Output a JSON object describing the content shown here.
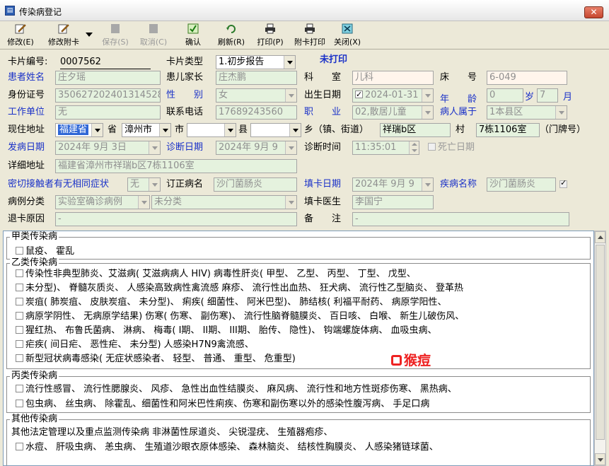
{
  "window": {
    "title": "传染病登记",
    "close_label": "✕"
  },
  "toolbar": {
    "buttons": [
      {
        "label": "修改(E)",
        "icon": "edit-icon",
        "enabled": true
      },
      {
        "label": "修改附卡",
        "icon": "edit-attachment-icon",
        "enabled": true
      },
      {
        "label": "保存(S)",
        "icon": "save-icon",
        "enabled": false
      },
      {
        "label": "取消(C)",
        "icon": "cancel-icon",
        "enabled": false
      },
      {
        "label": "确认",
        "icon": "confirm-icon",
        "enabled": true
      },
      {
        "label": "刷新(R)",
        "icon": "refresh-icon",
        "enabled": true
      },
      {
        "label": "打印(P)",
        "icon": "printer-icon",
        "enabled": true
      },
      {
        "label": "附卡打印",
        "icon": "attachment-printer-icon",
        "enabled": true
      },
      {
        "label": "关闭(X)",
        "icon": "close-window-icon",
        "enabled": true
      }
    ]
  },
  "form": {
    "card_no_label": "卡片编号:",
    "card_no": "0007562",
    "card_type_label": "卡片类型",
    "card_type": "1.初步报告",
    "print_status": "未打印",
    "patient_name_label": "患者姓名",
    "patient_name": "庄夕瑶",
    "guardian_label": "患儿家长",
    "guardian": "庄杰鹏",
    "dept_label": "科　　室",
    "dept": "儿科",
    "bed_label": "床　　号",
    "bed": "6-049",
    "id_label": "身份证号",
    "id": "350627202401314528",
    "gender_label": "性　　别",
    "gender": "女",
    "birth_label": "出生日期",
    "birth": "2024-01-31",
    "age_label": "年　　龄",
    "age_years": "0",
    "age_years_unit": "岁",
    "age_months": "7",
    "age_months_unit": "月",
    "work_label": "工作单位",
    "work": "无",
    "phone_label": "联系电话",
    "phone": "17689243560",
    "job_label": "职　　业",
    "job": "02,散居儿童",
    "belong_label": "病人属于",
    "belong": "1本县区",
    "addr_label": "现住地址",
    "province": "福建省",
    "province_unit": "省",
    "city": "漳州市",
    "city_unit": "市",
    "county": "",
    "county_unit": "县",
    "town_unit": "乡（镇、街道）",
    "town": "祥瑞b区",
    "village_unit": "村",
    "house": "7栋1106室",
    "house_unit": "（门牌号）",
    "onset_label": "发病日期",
    "onset": "2024年 9月 3日",
    "diag_date_label": "诊断日期",
    "diag_date": "2024年 9月 9",
    "diag_time_label": "诊断时间",
    "diag_time": "11:35:01",
    "death_label": "死亡日期",
    "detail_addr_label": "详细地址",
    "detail_addr": "福建省漳州市祥瑞b区7栋1106室",
    "contact_label": "密切接触者有无相同症状",
    "contact": "无",
    "revised_label": "订正病名",
    "revised": "沙门菌肠炎",
    "fill_date_label": "填卡日期",
    "fill_date": "2024年 9月 9",
    "disease_label": "疾病名称",
    "disease": "沙门菌肠炎",
    "case_class_label": "病例分类",
    "case_class": "实验室确诊病例",
    "case_sub": "未分类",
    "doctor_label": "填卡医生",
    "doctor": "李国宁",
    "reject_label": "退卡原因",
    "reject": "-",
    "remark_label": "备　　注",
    "remark": "-"
  },
  "classes": {
    "a_title": "甲类传染病",
    "a_lines": [
      "鼠疫、 霍乱"
    ],
    "b_title": "乙类传染病",
    "b_lines": [
      "传染性非典型肺炎、艾滋病( 艾滋病病人 HIV) 病毒性肝炎( 甲型、 乙型、 丙型、 丁型、 戊型、",
      "未分型)、 脊髓灰质炎、 人感染高致病性禽流感 麻疹、 流行性出血热、 狂犬病、 流行性乙型脑炎、 登革热",
      "炭疽( 肺炭疽、 皮肤炭疽、 未分型)、 痢疾( 细菌性、 阿米巴型)、 肺结核( 利福平耐药、 病原学阳性、",
      "病原学阴性、 无病原学结果) 伤寒( 伤寒、 副伤寒)、 流行性脑脊髓膜炎、 百日咳、 白喉、 新生儿破伤风、",
      "猩红热、 布鲁氏菌病、 淋病、 梅毒( I期、 II期、 III期、 胎传、 隐性)、 钩端螺旋体病、 血吸虫病、",
      "疟疾( 间日疟、 恶性疟、 未分型) 人感染H7N9禽流感、",
      "新型冠状病毒感染( 无症状感染者、 轻型、 普通、 重型、 危重型)"
    ],
    "stamp": "猴痘",
    "c_title": "丙类传染病",
    "c_lines": [
      "流行性感冒、 流行性腮腺炎、 风疹、 急性出血性结膜炎、 麻风病、 流行性和地方性斑疹伤寒、 黑热病、",
      "包虫病、 丝虫病、 除霍乱、细菌性和阿米巴性痢疾、伤寒和副伤寒以外的感染性腹泻病、 手足口病"
    ],
    "other_title": "其他传染病",
    "other_lines": [
      "其他法定管理以及重点监测传染病 非淋菌性尿道炎、 尖锐湿疣、 生殖器疱疹、",
      "水痘、 肝吸虫病、 恙虫病、 生殖道沙眼衣原体感染、 森林脑炎、 结核性胸膜炎、 人感染猪链球菌、"
    ]
  },
  "colors": {
    "label_blue": "#1a31c8",
    "field_green": "#e5f2de",
    "field_pink": "#fff5ec",
    "stamp_red": "#e22222"
  }
}
